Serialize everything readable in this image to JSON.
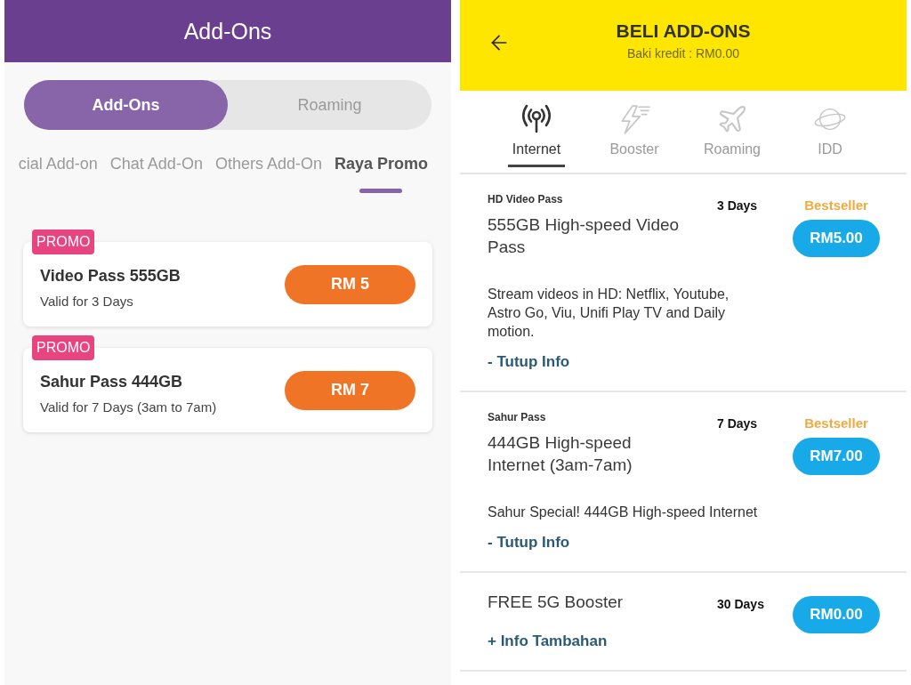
{
  "left_screen": {
    "header": {
      "title": "Add-Ons"
    },
    "segments": [
      {
        "label": "Add-Ons",
        "selected": true
      },
      {
        "label": "Roaming",
        "selected": false
      }
    ],
    "category_tabs": [
      {
        "label": "cial Add-on",
        "selected": false
      },
      {
        "label": "Chat Add-On",
        "selected": false
      },
      {
        "label": "Others Add-On",
        "selected": false
      },
      {
        "label": "Raya Promo",
        "selected": true
      }
    ],
    "offers": [
      {
        "badge": "PROMO",
        "name": "Video Pass 555GB",
        "validity": "Valid for 3 Days",
        "price": "RM 5"
      },
      {
        "badge": "PROMO",
        "name": "Sahur Pass 444GB",
        "validity": "Valid for 7 Days (3am to 7am)",
        "price": "RM 7"
      }
    ]
  },
  "right_screen": {
    "header": {
      "title": "BELI ADD-ONS",
      "subtitle": "Baki kredit : RM0.00"
    },
    "tabs": [
      {
        "kind": "antenna",
        "label": "Internet",
        "selected": true
      },
      {
        "kind": "lightning",
        "label": "Booster",
        "selected": false
      },
      {
        "kind": "plane",
        "label": "Roaming",
        "selected": false
      },
      {
        "kind": "globe",
        "label": "IDD",
        "selected": false
      }
    ],
    "plans": [
      {
        "category": "HD Video Pass",
        "title": "555GB High-speed Video Pass",
        "duration": "3 Days",
        "tag": "Bestseller",
        "price": "RM5.00",
        "description": "Stream videos in HD: Netflix, Youtube, Astro Go, Viu, Unifi Play TV and Daily motion.",
        "info_link": "- Tutup Info"
      },
      {
        "category": "Sahur Pass",
        "title": "444GB High-speed Internet (3am-7am)",
        "duration": "7 Days",
        "tag": "Bestseller",
        "price": "RM7.00",
        "description": "Sahur Special! 444GB High-speed Internet",
        "info_link": "- Tutup Info"
      },
      {
        "title": "FREE 5G Booster",
        "duration": "30 Days",
        "price": "RM0.00",
        "info_link": "+ Info Tambahan"
      }
    ]
  }
}
